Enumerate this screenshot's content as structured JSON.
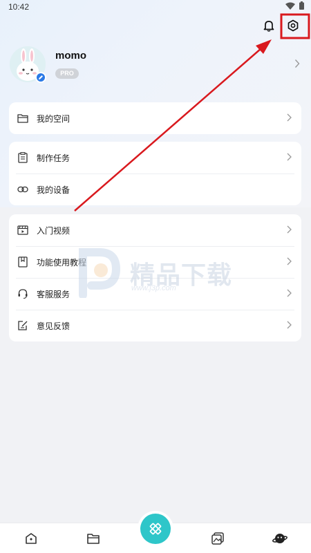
{
  "status_bar": {
    "time": "10:42"
  },
  "header": {
    "bell_icon": "bell-icon",
    "settings_icon": "settings-hexagon-icon"
  },
  "profile": {
    "username": "momo",
    "badge": "PRO",
    "avatar_icon": "bunny-avatar"
  },
  "menu": {
    "card1": [
      {
        "label": "我的空间",
        "icon": "folder-icon"
      }
    ],
    "card2": [
      {
        "label": "制作任务",
        "icon": "clipboard-icon"
      },
      {
        "label": "我的设备",
        "icon": "link-icon"
      }
    ],
    "card3": [
      {
        "label": "入门视频",
        "icon": "video-clapper-icon"
      },
      {
        "label": "功能使用教程",
        "icon": "book-icon"
      },
      {
        "label": "客服服务",
        "icon": "headset-icon"
      },
      {
        "label": "意见反馈",
        "icon": "feedback-icon"
      }
    ]
  },
  "watermark": {
    "title": "精品下载",
    "url": "www.j3p.com"
  },
  "bottom_nav": {
    "items": [
      "home-icon",
      "folder-icon",
      "create-icon",
      "gallery-icon",
      "planet-icon"
    ],
    "accent": "#2ec6c9"
  },
  "annotation_color": "#d9191e"
}
